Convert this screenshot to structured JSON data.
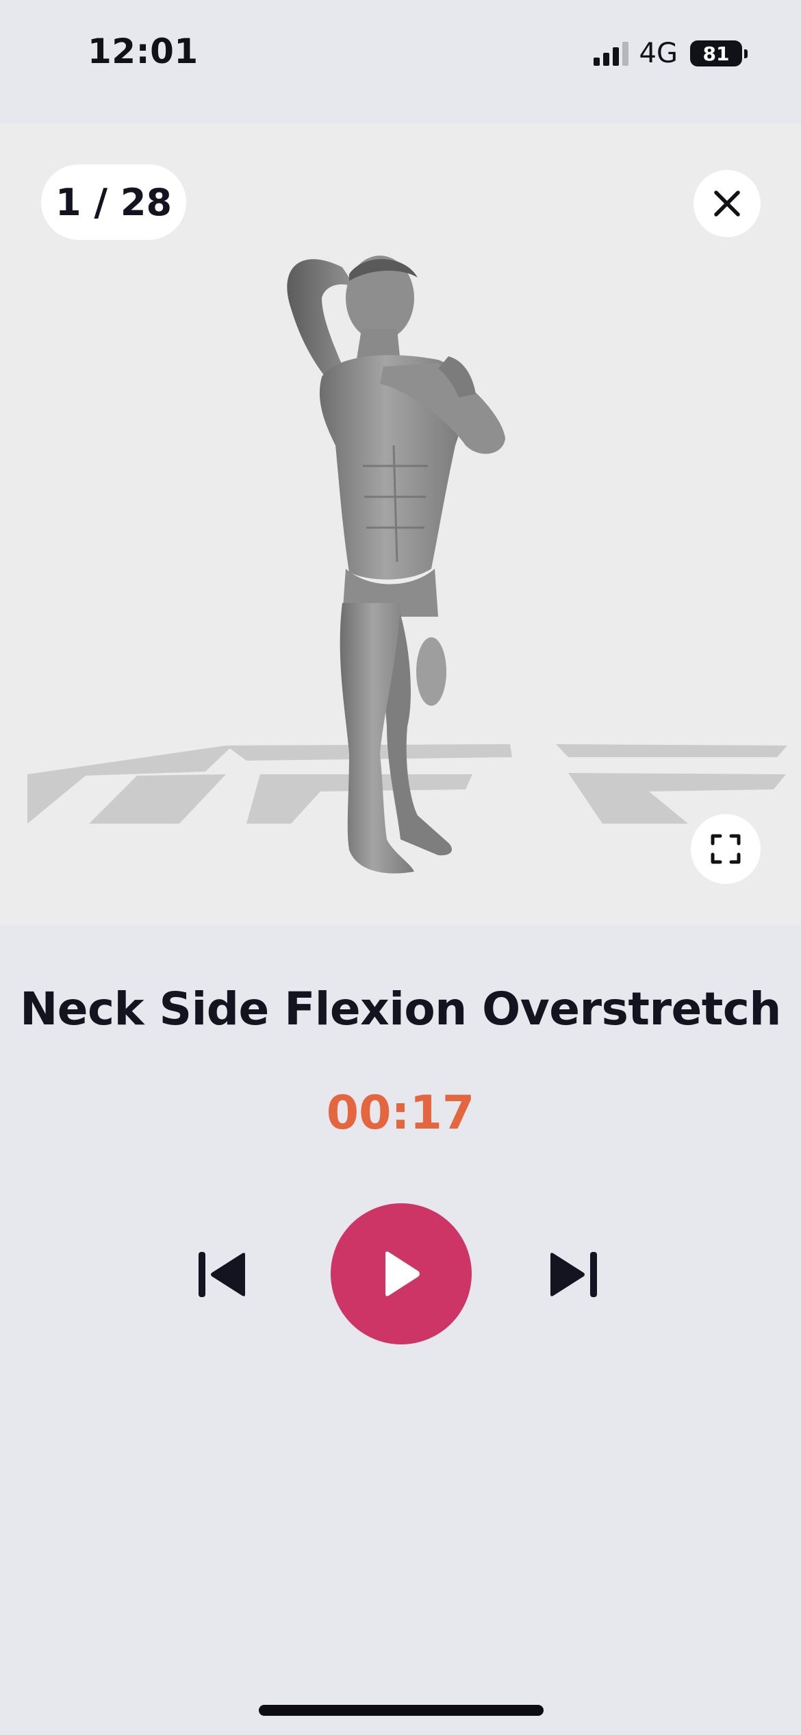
{
  "status_bar": {
    "time": "12:01",
    "network": "4G",
    "battery": "81"
  },
  "media": {
    "counter": "1 / 28",
    "icons": {
      "close": "close-icon",
      "fullscreen": "fullscreen-icon"
    }
  },
  "exercise": {
    "title": "Neck Side Flexion Overstretch",
    "timer": "00:17"
  },
  "player": {
    "icons": {
      "previous": "skip-previous-icon",
      "play": "play-icon",
      "next": "skip-next-icon"
    }
  },
  "colors": {
    "background": "#e6e8ee",
    "media_background": "#ececec",
    "timer": "#e4663f",
    "play_button": "#cc3565",
    "text": "#141420"
  }
}
